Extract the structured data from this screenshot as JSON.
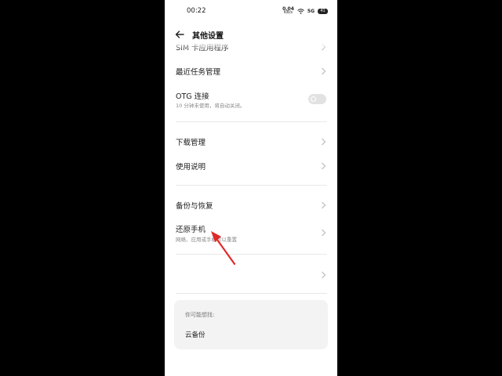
{
  "status": {
    "time": "00:22",
    "net_speed_value": "0.04",
    "net_speed_unit": "KB/s",
    "signal_text": "5G",
    "battery_level": "41"
  },
  "header": {
    "title": "其他设置"
  },
  "items": [
    {
      "label": "SIM 卡应用程序"
    },
    {
      "label": "最近任务管理"
    },
    {
      "label": "OTG 连接",
      "sub": "10 分钟未使用，将自动关闭。"
    },
    {
      "label": "下载管理"
    },
    {
      "label": "使用说明"
    },
    {
      "label": "备份与恢复"
    },
    {
      "label": "还原手机",
      "sub": "网络、应用或手机可以重置"
    }
  ],
  "suggest": {
    "heading": "你可能想找:",
    "items": [
      "云备份"
    ]
  },
  "colors": {
    "annotation_arrow": "#e0292a",
    "toggle_off": "#e2e2e2",
    "card_bg": "#f3f3f3"
  }
}
